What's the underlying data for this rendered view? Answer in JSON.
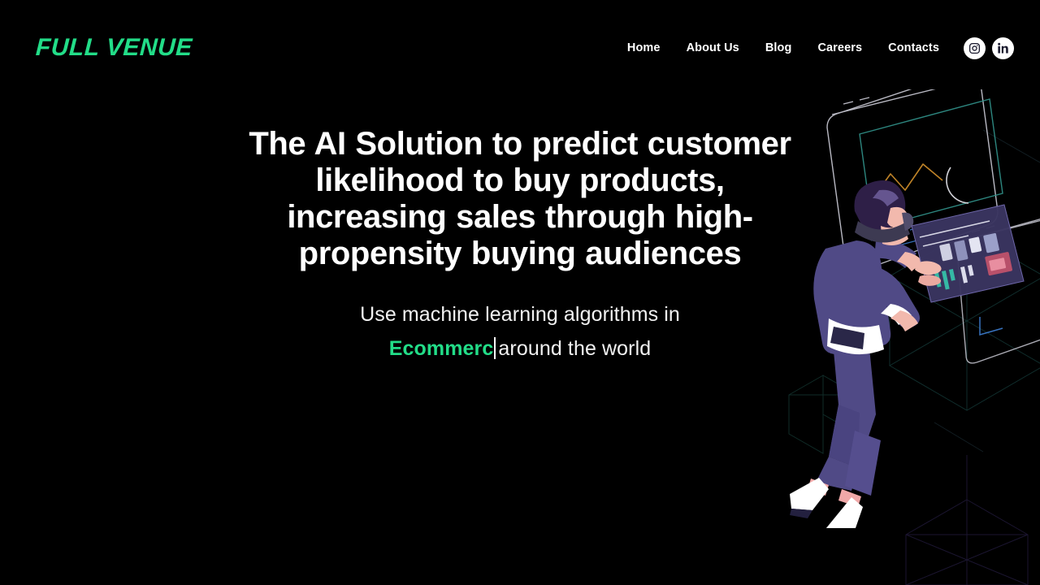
{
  "theme": {
    "background": "#000000",
    "accent_green": "#22dd88",
    "text_primary": "#ffffff",
    "text_secondary": "#f2f2f2",
    "social_chip_bg": "#ffffff",
    "social_chip_glyph": "#1a1a2e",
    "illustration_purple": "#504a86",
    "illustration_purple_dark": "#3a3566",
    "illustration_hair": "#2e1f47",
    "illustration_skin": "#f2b9ad",
    "illustration_white": "#ffffff",
    "panel_teal": "#2e8d86",
    "panel_orange": "#c98a2a",
    "panel_blue": "#2f6fd0",
    "grid_line_teal": "#0c2b2b",
    "grid_line_purple": "#1a1430"
  },
  "header": {
    "logo_text": "FULL VENUE",
    "nav_items": [
      {
        "label": "Home",
        "name": "nav-link-home"
      },
      {
        "label": "About Us",
        "name": "nav-link-about-us"
      },
      {
        "label": "Blog",
        "name": "nav-link-blog"
      },
      {
        "label": "Careers",
        "name": "nav-link-careers"
      },
      {
        "label": "Contacts",
        "name": "nav-link-contacts"
      }
    ],
    "social": [
      {
        "icon": "instagram-icon",
        "label": "Instagram"
      },
      {
        "icon": "linkedin-icon",
        "label": "LinkedIn"
      }
    ]
  },
  "hero": {
    "title": "The AI Solution to predict customer likelihood to buy products, increasing sales through high-propensity buying audiences",
    "subtitle_prefix": "Use machine learning algorithms in",
    "typed_word": "Ecommerc",
    "subtitle_suffix": "around the world",
    "cursor_visible": true
  },
  "illustration": {
    "name": "vr-person-with-dashboard-illustration",
    "description": "Isometric person wearing a VR headset interacting with a floating holographic dashboard panel, with outlined isometric browser windows and faint wireframe cubes in the background"
  }
}
